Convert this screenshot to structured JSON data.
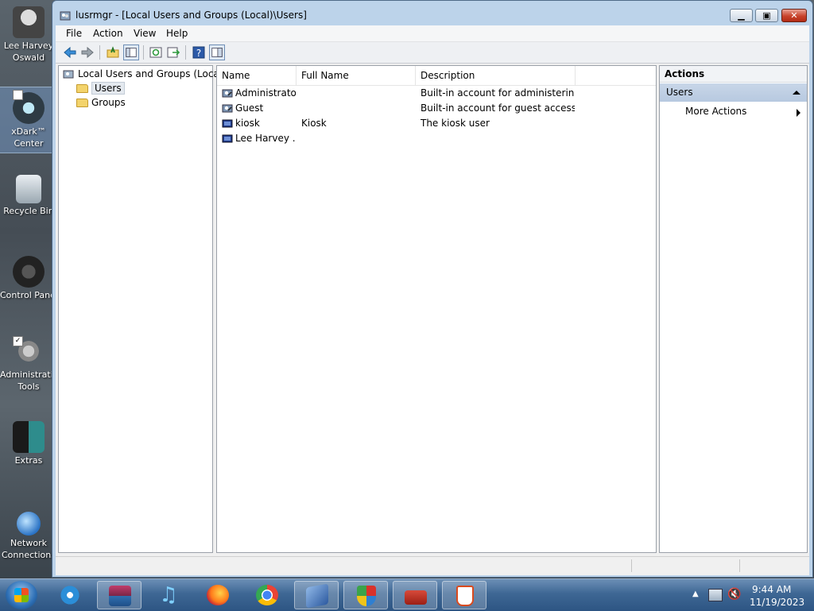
{
  "desktop": {
    "icons": [
      {
        "label1": "Lee Harvey",
        "label2": "Oswald"
      },
      {
        "label1": "xDark™",
        "label2": "Center"
      },
      {
        "label1": "Recycle Bin",
        "label2": ""
      },
      {
        "label1": "Control Panel",
        "label2": ""
      },
      {
        "label1": "Administrative",
        "label2": "Tools"
      },
      {
        "label1": "Extras",
        "label2": ""
      },
      {
        "label1": "Network",
        "label2": "Connections"
      }
    ]
  },
  "window": {
    "title": "lusrmgr - [Local Users and Groups (Local)\\Users]",
    "menu": [
      "File",
      "Action",
      "View",
      "Help"
    ],
    "tree": {
      "root": "Local Users and Groups (Local)",
      "children": [
        "Users",
        "Groups"
      ]
    },
    "list": {
      "columns": [
        "Name",
        "Full Name",
        "Description"
      ],
      "rows": [
        {
          "name": "Administrator",
          "full_name": "",
          "description": "Built-in account for administering..."
        },
        {
          "name": "Guest",
          "full_name": "",
          "description": "Built-in account for guest access t..."
        },
        {
          "name": "kiosk",
          "full_name": "Kiosk",
          "description": "The kiosk user"
        },
        {
          "name": "Lee Harvey ...",
          "full_name": "",
          "description": ""
        }
      ]
    },
    "actions": {
      "header": "Actions",
      "section": "Users",
      "items": [
        "More Actions"
      ]
    }
  },
  "taskbar": {
    "clock_time": "9:44 AM",
    "clock_date": "11/19/2023"
  },
  "colors": {
    "window_frame": "#bcd3ea",
    "taskbar": "#3e6794",
    "actions_section": "#b7c9e0",
    "close_button": "#c8432c"
  }
}
